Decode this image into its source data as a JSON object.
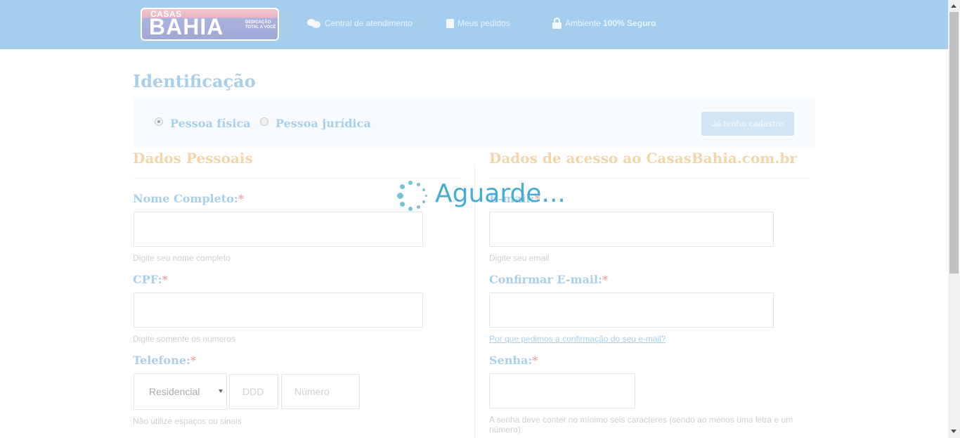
{
  "header": {
    "logo": {
      "line1": "CASAS",
      "line2": "BAHIA",
      "tagline": "DEDICAÇÃO TOTAL A VOCÊ"
    },
    "links": [
      {
        "icon": "chat-bubbles-icon",
        "label": "Central de atendimento"
      },
      {
        "icon": "document-icon",
        "label": "Meus pedidos"
      },
      {
        "icon": "lock-icon",
        "label_prefix": "Ambiente ",
        "label_bold": "100% Seguro"
      }
    ]
  },
  "page": {
    "title": "Identificação",
    "person_types": [
      {
        "label": "Pessoa física",
        "selected": true
      },
      {
        "label": "Pessoa jurídica",
        "selected": false
      }
    ],
    "have_account_button": "Já tenho cadastro"
  },
  "personal": {
    "title": "Dados Pessoais",
    "name": {
      "label": "Nome Completo:",
      "required": "*",
      "value": "",
      "hint": "Digite seu nome completo"
    },
    "cpf": {
      "label": "CPF:",
      "required": "*",
      "value": "",
      "hint": "Digite somente os números"
    },
    "phone": {
      "label": "Telefone:",
      "required": "*",
      "type_selected": "Residencial",
      "ddd_placeholder": "DDD",
      "number_placeholder": "Número",
      "hint": "Não utilize espaços ou sinais"
    }
  },
  "access": {
    "title": "Dados de acesso ao CasasBahia.com.br",
    "email": {
      "label": "E-mail:",
      "required": "*",
      "value": "",
      "hint": "Digite seu email"
    },
    "confirm_email": {
      "label": "Confirmar E-mail:",
      "required": "*",
      "value": "",
      "link": "Por que pedimos a confirmação do seu e-mail?"
    },
    "password": {
      "label": "Senha:",
      "required": "*",
      "value": "",
      "hint": "A senha deve conter no mínimo seis caracteres (sendo ao menos uma letra e um número)"
    }
  },
  "overlay": {
    "text": "Aguarde..."
  },
  "colors": {
    "header_bg": "#a4cdee",
    "loader": "#47acd4",
    "section_title": "#f3d5a9",
    "required": "#f0a6a8"
  }
}
